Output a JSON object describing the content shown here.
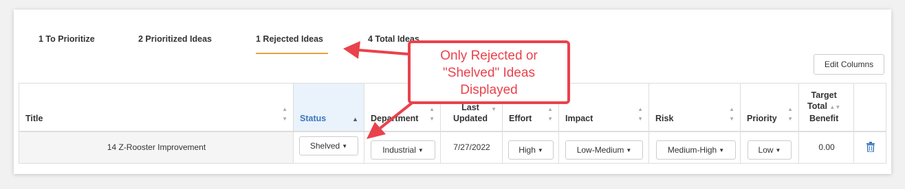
{
  "tabs": [
    {
      "label": "1 To Prioritize"
    },
    {
      "label": "2 Prioritized Ideas"
    },
    {
      "label": "1 Rejected Ideas"
    },
    {
      "label": "4 Total Ideas"
    }
  ],
  "edit_columns_label": "Edit Columns",
  "columns": {
    "title": "Title",
    "status": "Status",
    "department": "Department",
    "last_updated_1": "Last",
    "last_updated_2": "Updated",
    "effort": "Effort",
    "impact": "Impact",
    "risk": "Risk",
    "priority": "Priority",
    "target_1": "Target",
    "target_2": "Total",
    "target_3": "Benefit"
  },
  "row": {
    "title": "14 Z-Rooster Improvement",
    "status": "Shelved",
    "department": "Industrial",
    "last_updated": "7/27/2022",
    "effort": "High",
    "impact": "Low-Medium",
    "risk": "Medium-High",
    "priority": "Low",
    "target_total_benefit": "0.00"
  },
  "callout": {
    "line1": "Only Rejected or",
    "line2": "\"Shelved\" Ideas",
    "line3": "Displayed"
  },
  "colors": {
    "accent_underline": "#e8a23a",
    "active_header": "#3a76bd",
    "callout_red": "#e9424c",
    "trash_icon": "#3a76bd"
  },
  "icons": {
    "sort": "sort-icon",
    "sort_asc": "sort-asc-icon",
    "caret": "caret-down-icon",
    "delete": "trash-icon"
  }
}
